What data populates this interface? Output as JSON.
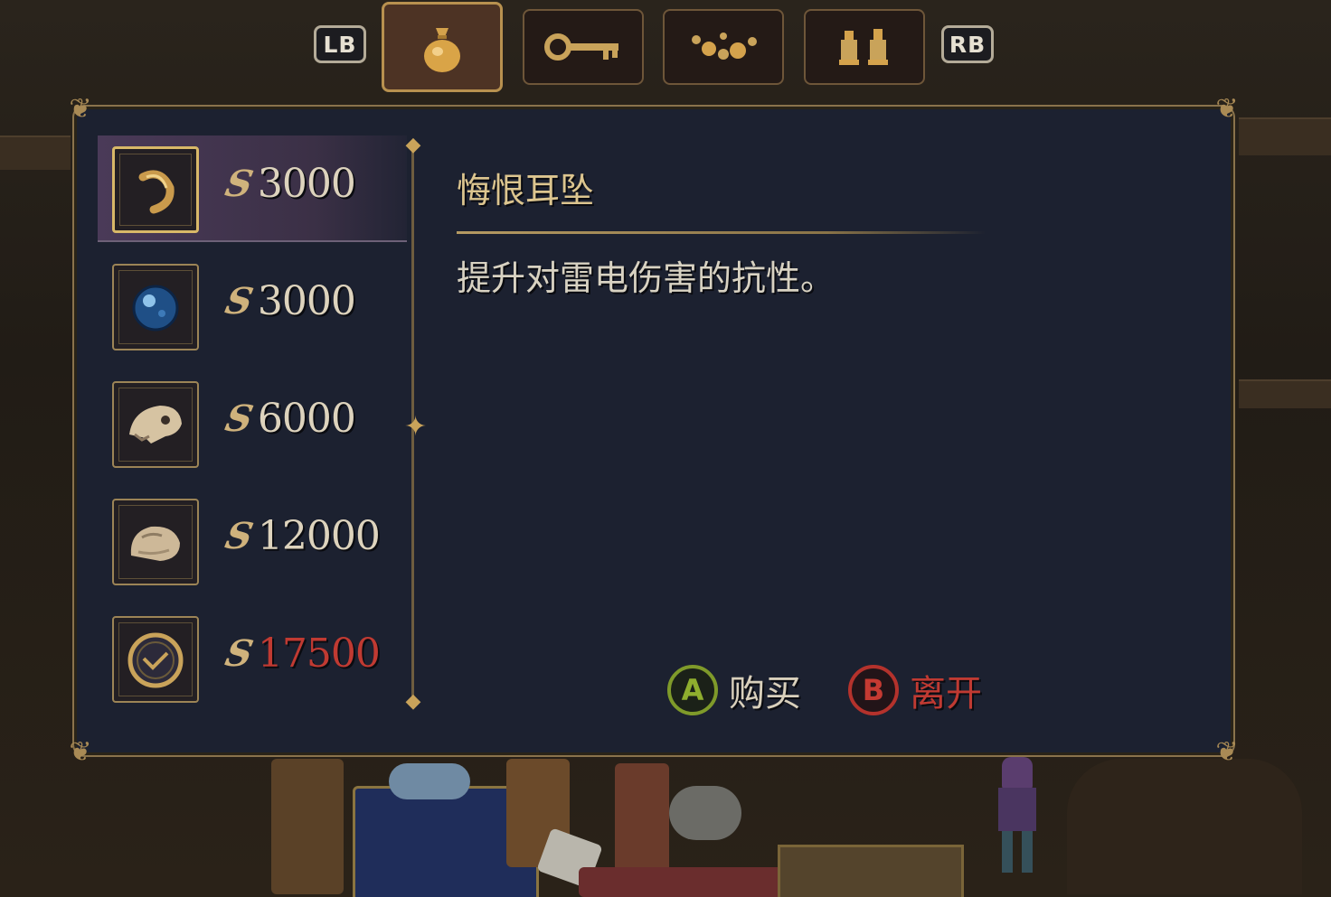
{
  "shoulder_left": "LB",
  "shoulder_right": "RB",
  "tabs": [
    {
      "icon": "coin-bag-icon",
      "active": true
    },
    {
      "icon": "key-icon",
      "active": false
    },
    {
      "icon": "bead-necklace-icon",
      "active": false
    },
    {
      "icon": "chess-pieces-icon",
      "active": false
    }
  ],
  "currency_symbol": "S",
  "items": [
    {
      "icon": "earring-icon",
      "price": "3000",
      "selected": true,
      "affordable": true
    },
    {
      "icon": "blue-orb-icon",
      "price": "3000",
      "selected": false,
      "affordable": true
    },
    {
      "icon": "animal-skull-icon",
      "price": "6000",
      "selected": false,
      "affordable": true
    },
    {
      "icon": "stone-icon",
      "price": "12000",
      "selected": false,
      "affordable": true
    },
    {
      "icon": "amulet-icon",
      "price": "17500",
      "selected": false,
      "affordable": false
    }
  ],
  "detail": {
    "title": "悔恨耳坠",
    "description": "提升对雷电伤害的抗性。"
  },
  "actions": {
    "buy_button": "A",
    "buy_label": "购买",
    "leave_button": "B",
    "leave_label": "离开"
  },
  "colors": {
    "panel": "#1c2130",
    "gold": "#c9a35a",
    "unaffordable": "#c03a32",
    "a_button": "#8fae2e",
    "b_button": "#c53a32"
  }
}
